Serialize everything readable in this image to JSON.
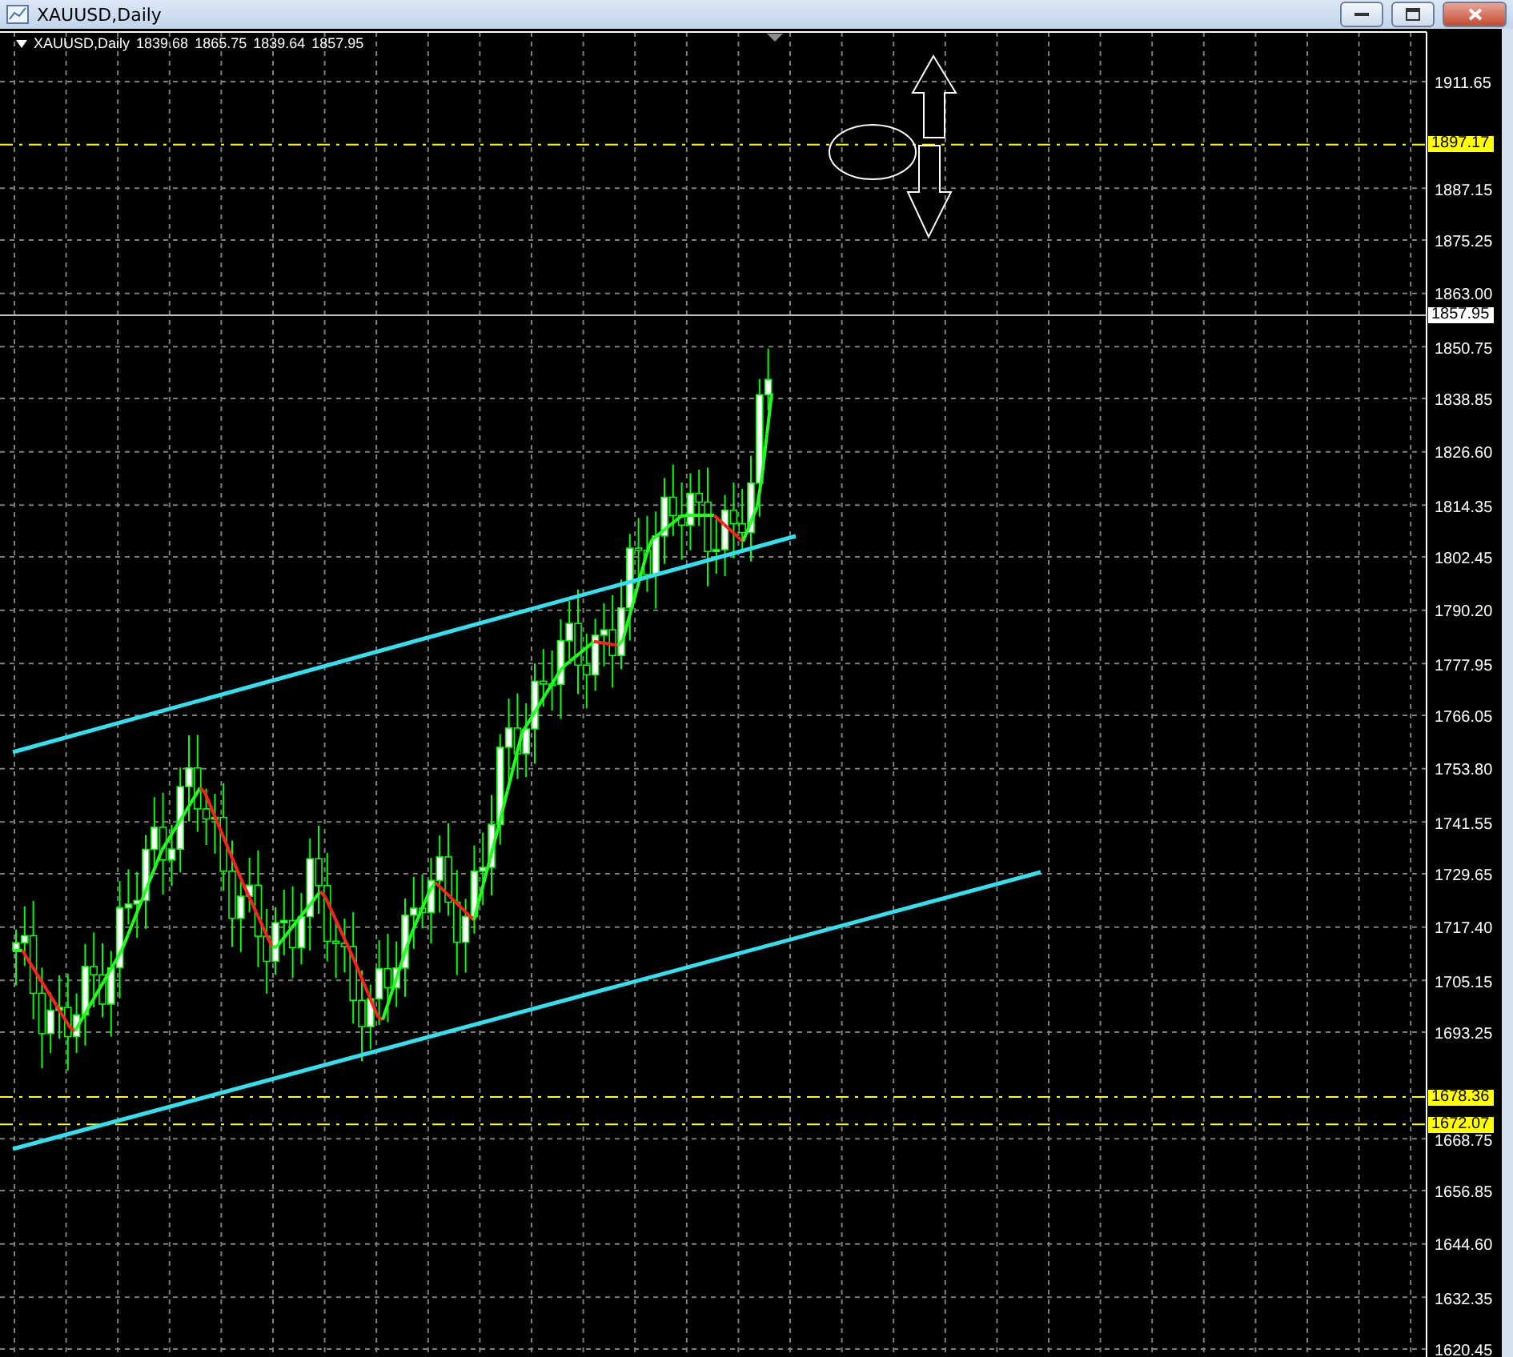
{
  "window": {
    "title": "XAUUSD,Daily"
  },
  "chart_header": {
    "symbol": "XAUUSD,Daily",
    "ohlc": [
      "1839.68",
      "1865.75",
      "1839.64",
      "1857.95"
    ]
  },
  "price_axis": [
    "1911.65",
    "1887.15",
    "1875.25",
    "1863.00",
    "1850.75",
    "1838.85",
    "1826.60",
    "1814.35",
    "1802.45",
    "1790.20",
    "1777.95",
    "1766.05",
    "1753.80",
    "1741.55",
    "1729.65",
    "1717.40",
    "1705.15",
    "1693.25",
    "1668.75",
    "1656.85",
    "1644.60",
    "1632.35",
    "1620.45"
  ],
  "price_levels": [
    {
      "kind": "line",
      "value": "1897.17"
    },
    {
      "kind": "current",
      "value": "1857.95"
    },
    {
      "kind": "line",
      "value": "1678.36"
    },
    {
      "kind": "line",
      "value": "1672.07"
    }
  ]
}
